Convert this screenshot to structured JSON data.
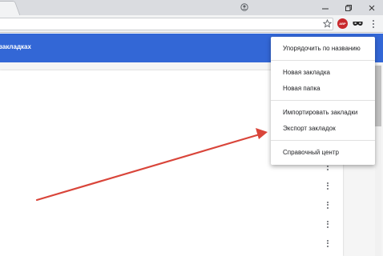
{
  "browser": {
    "icons": [
      "profile-icon",
      "minimize-icon",
      "restore-icon",
      "close-icon",
      "star-icon",
      "adblock-icon",
      "mask-icon",
      "menu-icon"
    ],
    "adblock_label": "ABP"
  },
  "header": {
    "title": "закладках",
    "color": "#3367d6"
  },
  "menu": {
    "items": [
      "Упорядочить по названию",
      "Новая закладка",
      "Новая папка",
      "Импортировать закладки",
      "Экспорт закладок",
      "Справочный центр"
    ]
  },
  "annotation": {
    "arrow_color": "#d9453a"
  }
}
